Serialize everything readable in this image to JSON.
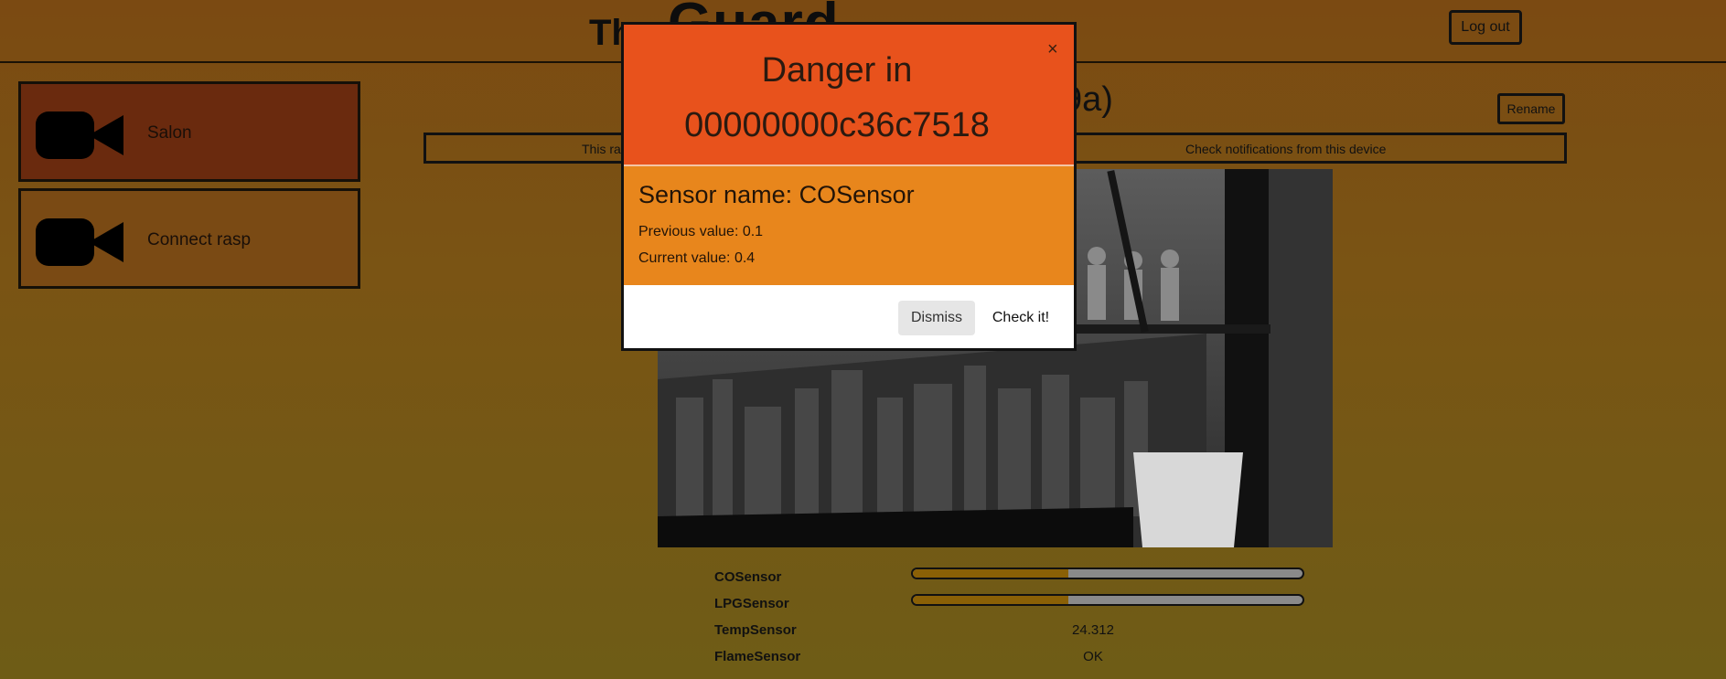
{
  "header": {
    "brand_small": "Th",
    "brand_big": "Guard",
    "logout_label": "Log out"
  },
  "sidebar": {
    "items": [
      {
        "label": "Salon",
        "icon": "camera-icon",
        "active": true
      },
      {
        "label": "Connect rasp",
        "icon": "camera-icon",
        "active": false
      }
    ]
  },
  "main": {
    "device_title_visible": "9a)",
    "rename_label": "Rename",
    "tab_left_visible": "This ra",
    "tab_right": "Check notifications from this device"
  },
  "sensors": [
    {
      "name": "COSensor",
      "kind": "bar",
      "level": 0.4
    },
    {
      "name": "LPGSensor",
      "kind": "bar",
      "level": 0.4
    },
    {
      "name": "TempSensor",
      "kind": "value",
      "value": "24.312"
    },
    {
      "name": "FlameSensor",
      "kind": "value",
      "value": "OK"
    }
  ],
  "modal": {
    "title_line1": "Danger in",
    "title_line2": "00000000c36c7518",
    "close_label": "×",
    "sensor_heading": "Sensor name: COSensor",
    "previous_value": "Previous value: 0.1",
    "current_value": "Current value: 0.4",
    "dismiss_label": "Dismiss",
    "check_label": "Check it!"
  },
  "colors": {
    "modal_header": "#e8521c",
    "modal_body": "#e8861c",
    "active_item": "#6a2a0e",
    "bar_fill": "#8a6006"
  }
}
